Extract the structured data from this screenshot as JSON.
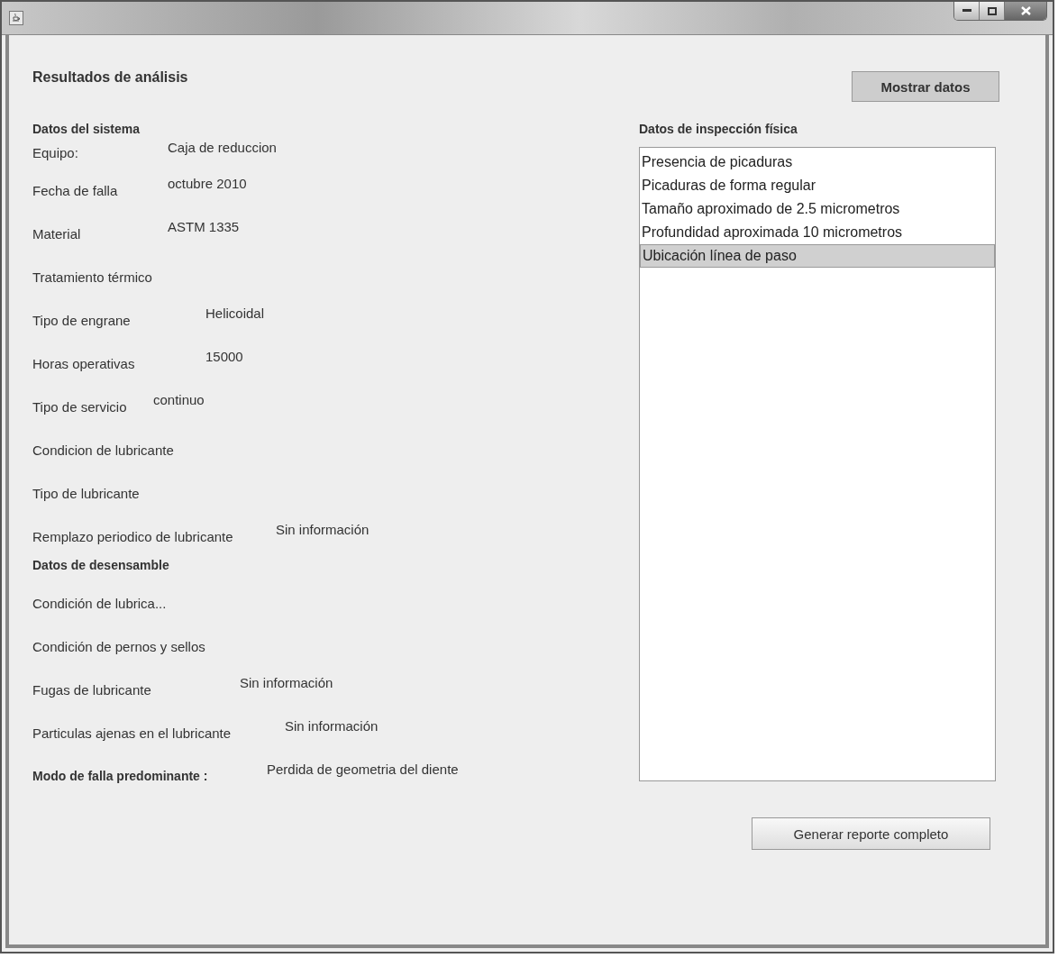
{
  "heading": "Resultados de análisis",
  "show_button": "Mostrar datos",
  "left_rows": [
    {
      "kind": "section",
      "label": "Datos del sistema"
    },
    {
      "kind": "field",
      "label": "Equipo:",
      "value": "Caja de reduccion"
    },
    {
      "kind": "field",
      "label": "Fecha de falla",
      "value": "octubre 2010"
    },
    {
      "kind": "field",
      "label": "Material",
      "value": "ASTM 1335"
    },
    {
      "kind": "field",
      "label": "Tratamiento térmico"
    },
    {
      "kind": "field",
      "label": "Tipo de engrane",
      "value": "Helicoidal"
    },
    {
      "kind": "field",
      "label": "Horas operativas",
      "value": "15000"
    },
    {
      "kind": "field",
      "label": "Tipo de servicio",
      "value": "continuo"
    },
    {
      "kind": "field",
      "label": "Condicion de lubricante"
    },
    {
      "kind": "field",
      "label": "Tipo de lubricante"
    },
    {
      "kind": "field",
      "label": "Remplazo periodico de lubricante",
      "value": "Sin información"
    },
    {
      "kind": "section",
      "label": "Datos de desensamble"
    },
    {
      "kind": "field",
      "label": "Condición de lubrica..."
    },
    {
      "kind": "field",
      "label": "Condición de pernos y sellos"
    },
    {
      "kind": "field",
      "label": "Fugas de lubricante",
      "value": "Sin información"
    },
    {
      "kind": "field",
      "label": "Particulas ajenas en el lubricante",
      "value": "Sin información"
    },
    {
      "kind": "result",
      "label": "Modo de falla predominante :",
      "value": "Perdida de geometria del diente"
    }
  ],
  "inspection": {
    "label": "Datos de inspección física",
    "items": [
      {
        "text": "Presencia de picaduras",
        "selected": false
      },
      {
        "text": "Picaduras de forma regular",
        "selected": false
      },
      {
        "text": "Tamaño aproximado de 2.5 micrometros",
        "selected": false
      },
      {
        "text": "Profundidad aproximada 10 micrometros",
        "selected": false
      },
      {
        "text": "Ubicación línea de paso",
        "selected": true
      }
    ]
  },
  "report_button": "Generar reporte completo"
}
